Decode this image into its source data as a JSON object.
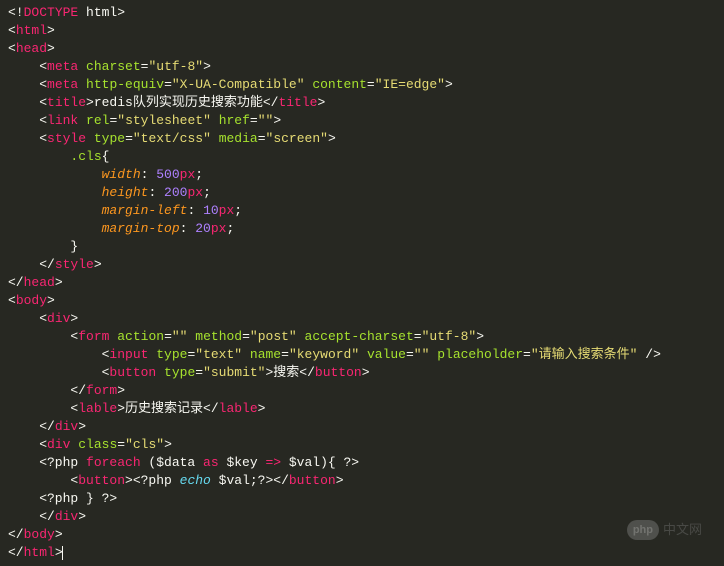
{
  "code": {
    "lines": [
      {
        "parts": [
          {
            "c": "p",
            "t": "<!"
          },
          {
            "c": "r",
            "t": "DOCTYPE"
          },
          {
            "c": "p",
            "t": " html>"
          }
        ]
      },
      {
        "parts": [
          {
            "c": "p",
            "t": "<"
          },
          {
            "c": "r",
            "t": "html"
          },
          {
            "c": "p",
            "t": ">"
          }
        ]
      },
      {
        "parts": [
          {
            "c": "p",
            "t": "<"
          },
          {
            "c": "r",
            "t": "head"
          },
          {
            "c": "p",
            "t": ">"
          }
        ]
      },
      {
        "parts": [
          {
            "c": "p",
            "t": "    <"
          },
          {
            "c": "r",
            "t": "meta"
          },
          {
            "c": "p",
            "t": " "
          },
          {
            "c": "g",
            "t": "charset"
          },
          {
            "c": "p",
            "t": "="
          },
          {
            "c": "y",
            "t": "\"utf-8\""
          },
          {
            "c": "p",
            "t": ">"
          }
        ]
      },
      {
        "parts": [
          {
            "c": "p",
            "t": "    <"
          },
          {
            "c": "r",
            "t": "meta"
          },
          {
            "c": "p",
            "t": " "
          },
          {
            "c": "g",
            "t": "http-equiv"
          },
          {
            "c": "p",
            "t": "="
          },
          {
            "c": "y",
            "t": "\"X-UA-Compatible\""
          },
          {
            "c": "p",
            "t": " "
          },
          {
            "c": "g",
            "t": "content"
          },
          {
            "c": "p",
            "t": "="
          },
          {
            "c": "y",
            "t": "\"IE=edge\""
          },
          {
            "c": "p",
            "t": ">"
          }
        ]
      },
      {
        "parts": [
          {
            "c": "p",
            "t": "    <"
          },
          {
            "c": "r",
            "t": "title"
          },
          {
            "c": "p",
            "t": ">redis队列实现历史搜索功能</"
          },
          {
            "c": "r",
            "t": "title"
          },
          {
            "c": "p",
            "t": ">"
          }
        ]
      },
      {
        "parts": [
          {
            "c": "p",
            "t": "    <"
          },
          {
            "c": "r",
            "t": "link"
          },
          {
            "c": "p",
            "t": " "
          },
          {
            "c": "g",
            "t": "rel"
          },
          {
            "c": "p",
            "t": "="
          },
          {
            "c": "y",
            "t": "\"stylesheet\""
          },
          {
            "c": "p",
            "t": " "
          },
          {
            "c": "g",
            "t": "href"
          },
          {
            "c": "p",
            "t": "="
          },
          {
            "c": "y",
            "t": "\"\""
          },
          {
            "c": "p",
            "t": ">"
          }
        ]
      },
      {
        "parts": [
          {
            "c": "p",
            "t": "    <"
          },
          {
            "c": "r",
            "t": "style"
          },
          {
            "c": "p",
            "t": " "
          },
          {
            "c": "g",
            "t": "type"
          },
          {
            "c": "p",
            "t": "="
          },
          {
            "c": "y",
            "t": "\"text/css\""
          },
          {
            "c": "p",
            "t": " "
          },
          {
            "c": "g",
            "t": "media"
          },
          {
            "c": "p",
            "t": "="
          },
          {
            "c": "y",
            "t": "\"screen\""
          },
          {
            "c": "p",
            "t": ">"
          }
        ]
      },
      {
        "parts": [
          {
            "c": "p",
            "t": "        "
          },
          {
            "c": "sel",
            "t": ".cls"
          },
          {
            "c": "p",
            "t": "{"
          }
        ]
      },
      {
        "parts": [
          {
            "c": "p",
            "t": "            "
          },
          {
            "c": "o",
            "t": "width"
          },
          {
            "c": "p",
            "t": ": "
          },
          {
            "c": "pu",
            "t": "500"
          },
          {
            "c": "r",
            "t": "px"
          },
          {
            "c": "p",
            "t": ";"
          }
        ]
      },
      {
        "parts": [
          {
            "c": "p",
            "t": "            "
          },
          {
            "c": "o",
            "t": "height"
          },
          {
            "c": "p",
            "t": ": "
          },
          {
            "c": "pu",
            "t": "200"
          },
          {
            "c": "r",
            "t": "px"
          },
          {
            "c": "p",
            "t": ";"
          }
        ]
      },
      {
        "parts": [
          {
            "c": "p",
            "t": "            "
          },
          {
            "c": "o",
            "t": "margin-left"
          },
          {
            "c": "p",
            "t": ": "
          },
          {
            "c": "pu",
            "t": "10"
          },
          {
            "c": "r",
            "t": "px"
          },
          {
            "c": "p",
            "t": ";"
          }
        ]
      },
      {
        "parts": [
          {
            "c": "p",
            "t": "            "
          },
          {
            "c": "o",
            "t": "margin-top"
          },
          {
            "c": "p",
            "t": ": "
          },
          {
            "c": "pu",
            "t": "20"
          },
          {
            "c": "r",
            "t": "px"
          },
          {
            "c": "p",
            "t": ";"
          }
        ]
      },
      {
        "parts": [
          {
            "c": "p",
            "t": "        }"
          }
        ]
      },
      {
        "parts": [
          {
            "c": "p",
            "t": "    </"
          },
          {
            "c": "r",
            "t": "style"
          },
          {
            "c": "p",
            "t": ">"
          }
        ]
      },
      {
        "parts": [
          {
            "c": "p",
            "t": "</"
          },
          {
            "c": "r",
            "t": "head"
          },
          {
            "c": "p",
            "t": ">"
          }
        ]
      },
      {
        "parts": [
          {
            "c": "p",
            "t": "<"
          },
          {
            "c": "r",
            "t": "body"
          },
          {
            "c": "p",
            "t": ">"
          }
        ]
      },
      {
        "parts": [
          {
            "c": "p",
            "t": "    <"
          },
          {
            "c": "r",
            "t": "div"
          },
          {
            "c": "p",
            "t": ">"
          }
        ]
      },
      {
        "parts": [
          {
            "c": "p",
            "t": "        <"
          },
          {
            "c": "r",
            "t": "form"
          },
          {
            "c": "p",
            "t": " "
          },
          {
            "c": "g",
            "t": "action"
          },
          {
            "c": "p",
            "t": "="
          },
          {
            "c": "y",
            "t": "\"\""
          },
          {
            "c": "p",
            "t": " "
          },
          {
            "c": "g",
            "t": "method"
          },
          {
            "c": "p",
            "t": "="
          },
          {
            "c": "y",
            "t": "\"post\""
          },
          {
            "c": "p",
            "t": " "
          },
          {
            "c": "g",
            "t": "accept-charset"
          },
          {
            "c": "p",
            "t": "="
          },
          {
            "c": "y",
            "t": "\"utf-8\""
          },
          {
            "c": "p",
            "t": ">"
          }
        ]
      },
      {
        "parts": [
          {
            "c": "p",
            "t": "            <"
          },
          {
            "c": "r",
            "t": "input"
          },
          {
            "c": "p",
            "t": " "
          },
          {
            "c": "g",
            "t": "type"
          },
          {
            "c": "p",
            "t": "="
          },
          {
            "c": "y",
            "t": "\"text\""
          },
          {
            "c": "p",
            "t": " "
          },
          {
            "c": "g",
            "t": "name"
          },
          {
            "c": "p",
            "t": "="
          },
          {
            "c": "y",
            "t": "\"keyword\""
          },
          {
            "c": "p",
            "t": " "
          },
          {
            "c": "g",
            "t": "value"
          },
          {
            "c": "p",
            "t": "="
          },
          {
            "c": "y",
            "t": "\"\""
          },
          {
            "c": "p",
            "t": " "
          },
          {
            "c": "g",
            "t": "placeholder"
          },
          {
            "c": "p",
            "t": "="
          },
          {
            "c": "y",
            "t": "\"请输入搜索条件\""
          },
          {
            "c": "p",
            "t": " />"
          }
        ]
      },
      {
        "parts": [
          {
            "c": "p",
            "t": "            <"
          },
          {
            "c": "r",
            "t": "button"
          },
          {
            "c": "p",
            "t": " "
          },
          {
            "c": "g",
            "t": "type"
          },
          {
            "c": "p",
            "t": "="
          },
          {
            "c": "y",
            "t": "\"submit\""
          },
          {
            "c": "p",
            "t": ">搜索</"
          },
          {
            "c": "r",
            "t": "button"
          },
          {
            "c": "p",
            "t": ">"
          }
        ]
      },
      {
        "parts": [
          {
            "c": "p",
            "t": "        </"
          },
          {
            "c": "r",
            "t": "form"
          },
          {
            "c": "p",
            "t": ">"
          }
        ]
      },
      {
        "parts": [
          {
            "c": "p",
            "t": "        <"
          },
          {
            "c": "r",
            "t": "lable"
          },
          {
            "c": "p",
            "t": ">历史搜索记录</"
          },
          {
            "c": "r",
            "t": "lable"
          },
          {
            "c": "p",
            "t": ">"
          }
        ]
      },
      {
        "parts": [
          {
            "c": "p",
            "t": "    </"
          },
          {
            "c": "r",
            "t": "div"
          },
          {
            "c": "p",
            "t": ">"
          }
        ]
      },
      {
        "parts": [
          {
            "c": "p",
            "t": "    <"
          },
          {
            "c": "r",
            "t": "div"
          },
          {
            "c": "p",
            "t": " "
          },
          {
            "c": "g",
            "t": "class"
          },
          {
            "c": "p",
            "t": "="
          },
          {
            "c": "y",
            "t": "\"cls\""
          },
          {
            "c": "p",
            "t": ">"
          }
        ]
      },
      {
        "parts": [
          {
            "c": "p",
            "t": "    <?php "
          },
          {
            "c": "r",
            "t": "foreach"
          },
          {
            "c": "p",
            "t": " ($data "
          },
          {
            "c": "r",
            "t": "as"
          },
          {
            "c": "p",
            "t": " $key "
          },
          {
            "c": "r",
            "t": "=>"
          },
          {
            "c": "p",
            "t": " $val){ ?>"
          }
        ]
      },
      {
        "parts": [
          {
            "c": "p",
            "t": "        <"
          },
          {
            "c": "r",
            "t": "button"
          },
          {
            "c": "p",
            "t": "><?php "
          },
          {
            "c": "b",
            "t": "echo"
          },
          {
            "c": "p",
            "t": " $val;?></"
          },
          {
            "c": "r",
            "t": "button"
          },
          {
            "c": "p",
            "t": ">"
          }
        ]
      },
      {
        "parts": [
          {
            "c": "p",
            "t": "    <?php } ?>"
          }
        ]
      },
      {
        "parts": [
          {
            "c": "p",
            "t": "    </"
          },
          {
            "c": "r",
            "t": "div"
          },
          {
            "c": "p",
            "t": ">"
          }
        ]
      },
      {
        "parts": [
          {
            "c": "p",
            "t": "</"
          },
          {
            "c": "r",
            "t": "body"
          },
          {
            "c": "p",
            "t": ">"
          }
        ]
      },
      {
        "cursor": true,
        "parts": [
          {
            "c": "p",
            "t": "</"
          },
          {
            "c": "r",
            "t": "html"
          },
          {
            "c": "p",
            "t": ">"
          }
        ]
      }
    ]
  },
  "watermark": {
    "badge": "php",
    "text": "中文网"
  }
}
